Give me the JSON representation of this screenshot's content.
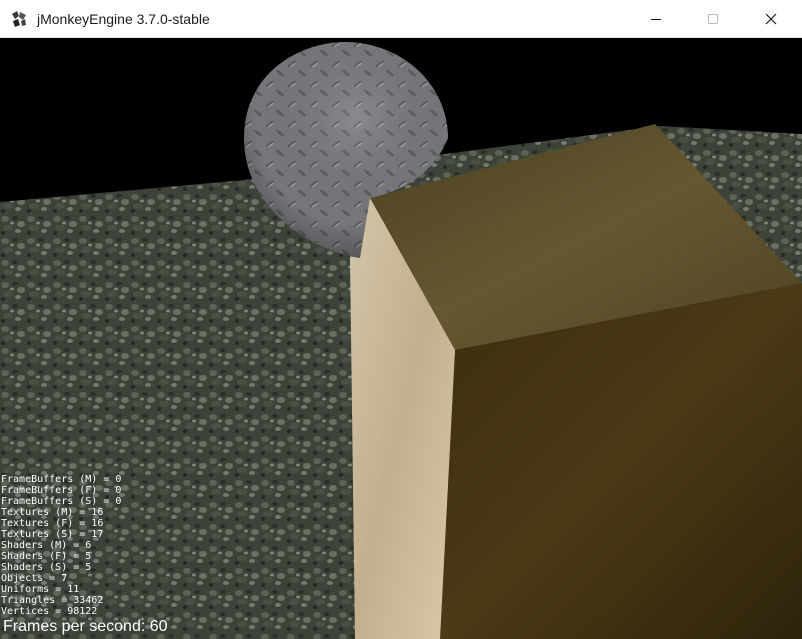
{
  "window": {
    "title": "jMonkeyEngine 3.7.0-stable",
    "icon": "jmonkey-logo-icon",
    "controls": {
      "minimize": "minimize-icon",
      "maximize": "maximize-icon",
      "close": "close-icon"
    }
  },
  "scene": {
    "objects": [
      "ground-plane",
      "sphere",
      "light-box",
      "dark-box"
    ],
    "colors": {
      "sky": "#000000",
      "ground": "#3b4236",
      "sphere": "#7a7a7e",
      "light_box": "#cdbb9e",
      "dark_box_top": "#5a4d2a",
      "dark_box_front": "#3a2d10"
    }
  },
  "stats": [
    "FrameBuffers (M) = 0",
    "FrameBuffers (F) = 0",
    "FrameBuffers (S) = 0",
    "Textures (M) = 16",
    "Textures (F) = 16",
    "Textures (S) = 17",
    "Shaders (M) = 6",
    "Shaders (F) = 5",
    "Shaders (S) = 5",
    "Objects = 7",
    "Uniforms = 11",
    "Triangles = 33462",
    "Vertices = 98122"
  ],
  "fps_text": "Frames per second: 60"
}
